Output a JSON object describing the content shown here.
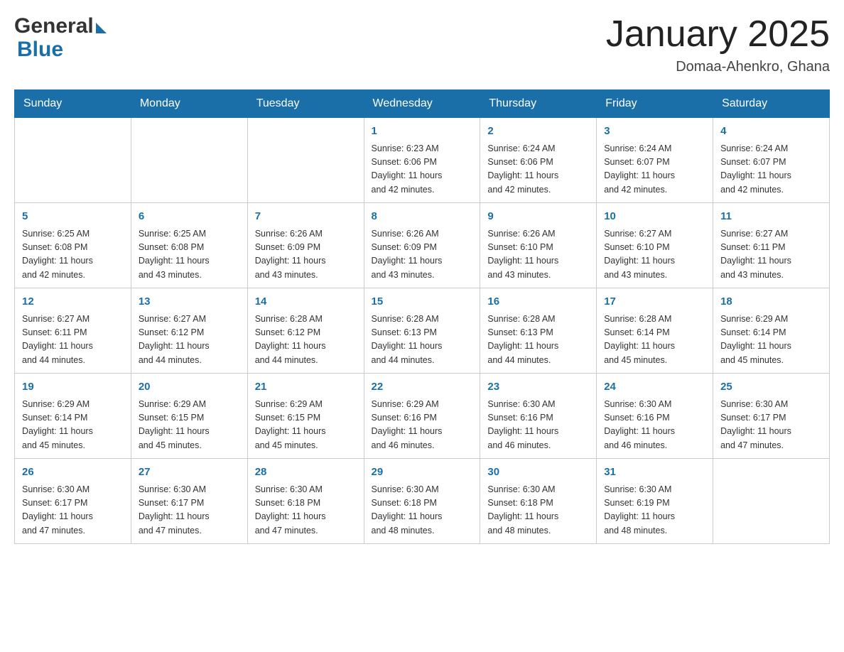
{
  "header": {
    "logo_general": "General",
    "logo_blue": "Blue",
    "title": "January 2025",
    "location": "Domaa-Ahenkro, Ghana"
  },
  "calendar": {
    "days_of_week": [
      "Sunday",
      "Monday",
      "Tuesday",
      "Wednesday",
      "Thursday",
      "Friday",
      "Saturday"
    ],
    "weeks": [
      {
        "days": [
          {
            "number": "",
            "info": ""
          },
          {
            "number": "",
            "info": ""
          },
          {
            "number": "",
            "info": ""
          },
          {
            "number": "1",
            "info": "Sunrise: 6:23 AM\nSunset: 6:06 PM\nDaylight: 11 hours\nand 42 minutes."
          },
          {
            "number": "2",
            "info": "Sunrise: 6:24 AM\nSunset: 6:06 PM\nDaylight: 11 hours\nand 42 minutes."
          },
          {
            "number": "3",
            "info": "Sunrise: 6:24 AM\nSunset: 6:07 PM\nDaylight: 11 hours\nand 42 minutes."
          },
          {
            "number": "4",
            "info": "Sunrise: 6:24 AM\nSunset: 6:07 PM\nDaylight: 11 hours\nand 42 minutes."
          }
        ]
      },
      {
        "days": [
          {
            "number": "5",
            "info": "Sunrise: 6:25 AM\nSunset: 6:08 PM\nDaylight: 11 hours\nand 42 minutes."
          },
          {
            "number": "6",
            "info": "Sunrise: 6:25 AM\nSunset: 6:08 PM\nDaylight: 11 hours\nand 43 minutes."
          },
          {
            "number": "7",
            "info": "Sunrise: 6:26 AM\nSunset: 6:09 PM\nDaylight: 11 hours\nand 43 minutes."
          },
          {
            "number": "8",
            "info": "Sunrise: 6:26 AM\nSunset: 6:09 PM\nDaylight: 11 hours\nand 43 minutes."
          },
          {
            "number": "9",
            "info": "Sunrise: 6:26 AM\nSunset: 6:10 PM\nDaylight: 11 hours\nand 43 minutes."
          },
          {
            "number": "10",
            "info": "Sunrise: 6:27 AM\nSunset: 6:10 PM\nDaylight: 11 hours\nand 43 minutes."
          },
          {
            "number": "11",
            "info": "Sunrise: 6:27 AM\nSunset: 6:11 PM\nDaylight: 11 hours\nand 43 minutes."
          }
        ]
      },
      {
        "days": [
          {
            "number": "12",
            "info": "Sunrise: 6:27 AM\nSunset: 6:11 PM\nDaylight: 11 hours\nand 44 minutes."
          },
          {
            "number": "13",
            "info": "Sunrise: 6:27 AM\nSunset: 6:12 PM\nDaylight: 11 hours\nand 44 minutes."
          },
          {
            "number": "14",
            "info": "Sunrise: 6:28 AM\nSunset: 6:12 PM\nDaylight: 11 hours\nand 44 minutes."
          },
          {
            "number": "15",
            "info": "Sunrise: 6:28 AM\nSunset: 6:13 PM\nDaylight: 11 hours\nand 44 minutes."
          },
          {
            "number": "16",
            "info": "Sunrise: 6:28 AM\nSunset: 6:13 PM\nDaylight: 11 hours\nand 44 minutes."
          },
          {
            "number": "17",
            "info": "Sunrise: 6:28 AM\nSunset: 6:14 PM\nDaylight: 11 hours\nand 45 minutes."
          },
          {
            "number": "18",
            "info": "Sunrise: 6:29 AM\nSunset: 6:14 PM\nDaylight: 11 hours\nand 45 minutes."
          }
        ]
      },
      {
        "days": [
          {
            "number": "19",
            "info": "Sunrise: 6:29 AM\nSunset: 6:14 PM\nDaylight: 11 hours\nand 45 minutes."
          },
          {
            "number": "20",
            "info": "Sunrise: 6:29 AM\nSunset: 6:15 PM\nDaylight: 11 hours\nand 45 minutes."
          },
          {
            "number": "21",
            "info": "Sunrise: 6:29 AM\nSunset: 6:15 PM\nDaylight: 11 hours\nand 45 minutes."
          },
          {
            "number": "22",
            "info": "Sunrise: 6:29 AM\nSunset: 6:16 PM\nDaylight: 11 hours\nand 46 minutes."
          },
          {
            "number": "23",
            "info": "Sunrise: 6:30 AM\nSunset: 6:16 PM\nDaylight: 11 hours\nand 46 minutes."
          },
          {
            "number": "24",
            "info": "Sunrise: 6:30 AM\nSunset: 6:16 PM\nDaylight: 11 hours\nand 46 minutes."
          },
          {
            "number": "25",
            "info": "Sunrise: 6:30 AM\nSunset: 6:17 PM\nDaylight: 11 hours\nand 47 minutes."
          }
        ]
      },
      {
        "days": [
          {
            "number": "26",
            "info": "Sunrise: 6:30 AM\nSunset: 6:17 PM\nDaylight: 11 hours\nand 47 minutes."
          },
          {
            "number": "27",
            "info": "Sunrise: 6:30 AM\nSunset: 6:17 PM\nDaylight: 11 hours\nand 47 minutes."
          },
          {
            "number": "28",
            "info": "Sunrise: 6:30 AM\nSunset: 6:18 PM\nDaylight: 11 hours\nand 47 minutes."
          },
          {
            "number": "29",
            "info": "Sunrise: 6:30 AM\nSunset: 6:18 PM\nDaylight: 11 hours\nand 48 minutes."
          },
          {
            "number": "30",
            "info": "Sunrise: 6:30 AM\nSunset: 6:18 PM\nDaylight: 11 hours\nand 48 minutes."
          },
          {
            "number": "31",
            "info": "Sunrise: 6:30 AM\nSunset: 6:19 PM\nDaylight: 11 hours\nand 48 minutes."
          },
          {
            "number": "",
            "info": ""
          }
        ]
      }
    ]
  }
}
